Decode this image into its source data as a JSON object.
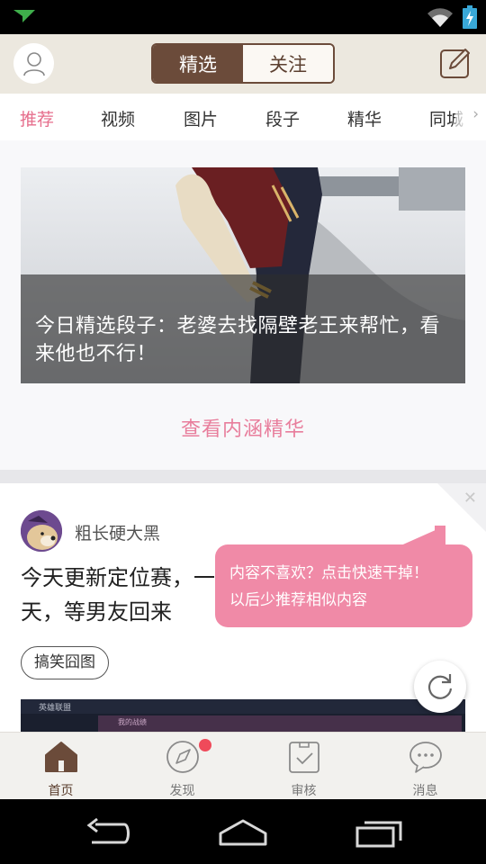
{
  "header": {
    "segments": [
      {
        "label": "精选",
        "active": true
      },
      {
        "label": "关注",
        "active": false
      }
    ]
  },
  "tabs": [
    "推荐",
    "视频",
    "图片",
    "段子",
    "精华",
    "同城"
  ],
  "featured": {
    "title": "今日精选段子：老婆去找隔壁老王来帮忙，看来他也不行！",
    "link": "查看内涵精华"
  },
  "post": {
    "username": "粗长硬大黑",
    "text": "今天更新定位赛，一天，等男友回来",
    "tag": "搞笑囧图",
    "image_label": "英雄联盟",
    "image_panel_label": "我的战绩",
    "image_refresh": "刷新"
  },
  "tooltip": {
    "line1": "内容不喜欢？点击快速干掉！",
    "line2": "以后少推荐相似内容"
  },
  "bottom_nav": [
    {
      "label": "首页",
      "icon": "home-icon",
      "active": true
    },
    {
      "label": "发现",
      "icon": "compass-icon",
      "active": false,
      "badge": true
    },
    {
      "label": "审核",
      "icon": "review-icon",
      "active": false
    },
    {
      "label": "消息",
      "icon": "message-icon",
      "active": false
    }
  ],
  "colors": {
    "brand_brown": "#6b4b3a",
    "accent_pink": "#e66e8c",
    "tooltip_pink": "#f08aa7",
    "badge_red": "#ef4a5a"
  }
}
